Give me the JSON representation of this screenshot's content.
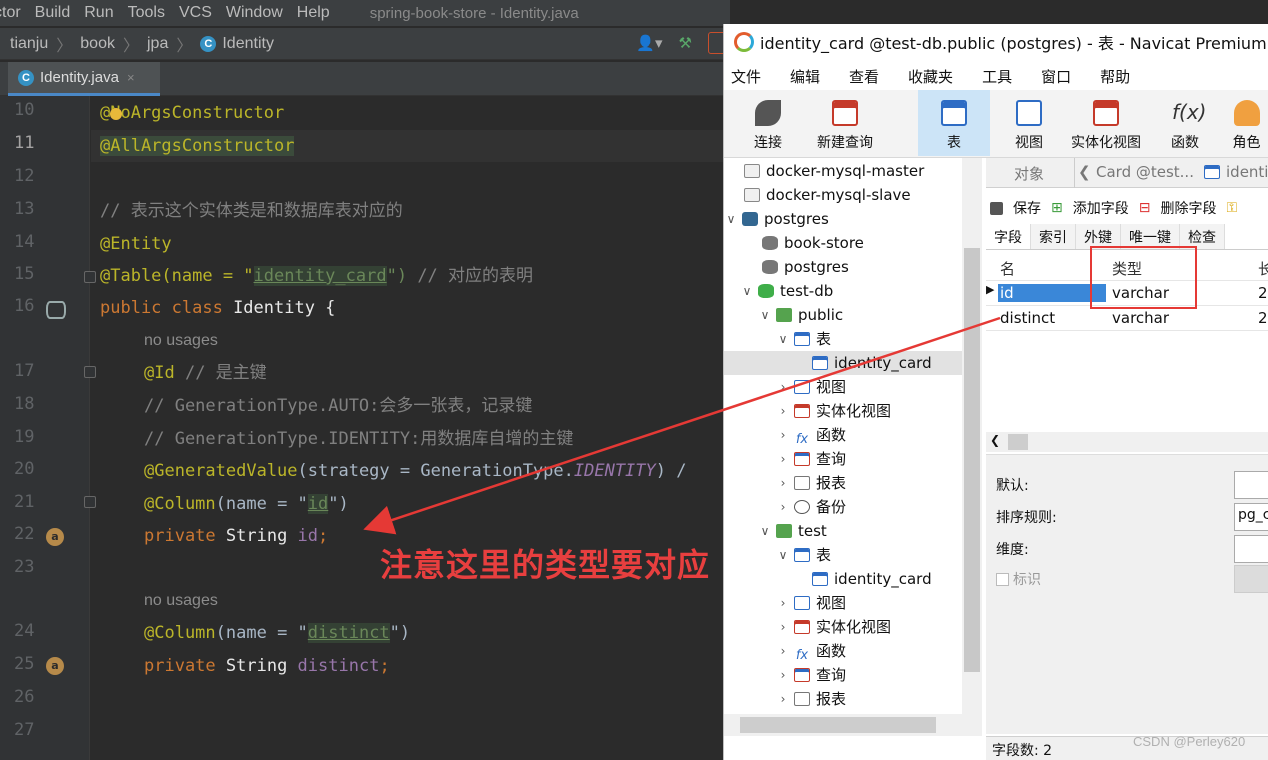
{
  "ide": {
    "menu": [
      "ctor",
      "Build",
      "Run",
      "Tools",
      "VCS",
      "Window",
      "Help"
    ],
    "window_title": "spring-book-store - Identity.java",
    "breadcrumb": [
      "tianju",
      "book",
      "jpa",
      "Identity"
    ],
    "tab": {
      "label": "Identity.java",
      "close": "×"
    },
    "line_numbers": [
      "10",
      "11",
      "12",
      "13",
      "14",
      "15",
      "16",
      "",
      "17",
      "18",
      "19",
      "20",
      "21",
      "22",
      "23",
      "",
      "24",
      "25",
      "26",
      "27"
    ],
    "code": {
      "l10": "@NoArgsConstructor",
      "l11": "@AllArgsConstructor",
      "l13": "// 表示这个实体类是和数据库表对应的",
      "l14": "@Entity",
      "l15a": "@Table(name = \"",
      "l15b": "identity_card",
      "l15c": "\") ",
      "l15d": "// 对应的表明",
      "l16a": "public class ",
      "l16b": "Identity {",
      "nousage1": "no usages",
      "l17a": "@Id ",
      "l17b": "// 是主键",
      "l18": "// GenerationType.AUTO:会多一张表，记录键",
      "l19": "// GenerationType.IDENTITY:用数据库自增的主键",
      "l20a": "@GeneratedValue",
      "l20b": "(strategy = GenerationType.",
      "l20c": "IDENTITY",
      "l20d": ") /",
      "l21a": "@Column",
      "l21b": "(name = \"",
      "l21c": "id",
      "l21d": "\")",
      "l22a": "private ",
      "l22b": "String ",
      "l22c": "id",
      "l22d": ";",
      "nousage2": "no usages",
      "l24a": "@Column",
      "l24b": "(name = \"",
      "l24c": "distinct",
      "l24d": "\")",
      "l25a": "private ",
      "l25b": "String ",
      "l25c": "distinct",
      "l25d": ";"
    },
    "annotation_text": "注意这里的类型要对应"
  },
  "navicat": {
    "title": "identity_card @test-db.public (postgres) - 表 - Navicat Premium",
    "menu": [
      "文件",
      "编辑",
      "查看",
      "收藏夹",
      "工具",
      "窗口",
      "帮助"
    ],
    "toolbar": [
      "连接",
      "新建查询",
      "表",
      "视图",
      "实体化视图",
      "函数",
      "角色"
    ],
    "tree": [
      "docker-mysql-master",
      "docker-mysql-slave",
      "postgres",
      "book-store",
      "postgres",
      "test-db",
      "public",
      "表",
      "identity_card",
      "视图",
      "实体化视图",
      "函数",
      "查询",
      "报表",
      "备份",
      "test",
      "表",
      "identity_card",
      "视图",
      "实体化视图",
      "函数",
      "查询",
      "报表"
    ],
    "object_tabs": [
      "对象",
      "Card @test...",
      "identi"
    ],
    "field_toolbar": [
      "保存",
      "添加字段",
      "删除字段"
    ],
    "field_tabs": [
      "字段",
      "索引",
      "外键",
      "唯一键",
      "检查"
    ],
    "grid_headers": [
      "名",
      "类型",
      "长"
    ],
    "rows": [
      {
        "name": "id",
        "type": "varchar",
        "len": "2"
      },
      {
        "name": "distinct",
        "type": "varchar",
        "len": "2"
      }
    ],
    "props": {
      "default": "默认:",
      "collation": "排序规则:",
      "collation_value": "pg_c",
      "dimension": "维度:",
      "identity": "标识"
    },
    "status": "字段数: 2"
  },
  "watermark": "CSDN @Perley620",
  "colors": {
    "accent": "#e53935",
    "selection": "#3a87d8"
  }
}
